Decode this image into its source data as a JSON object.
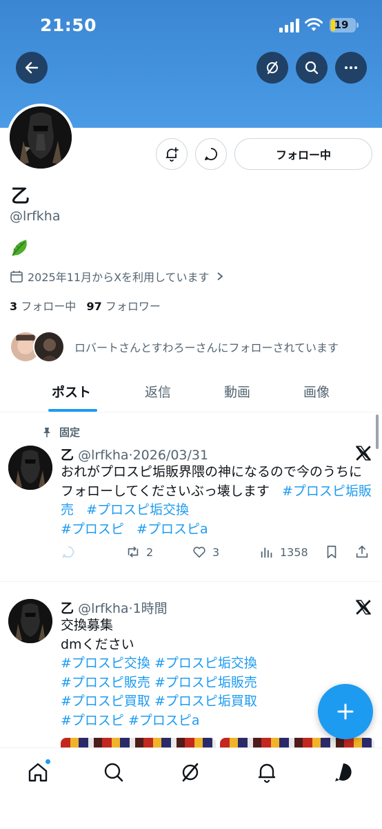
{
  "status_bar": {
    "time": "21:50",
    "battery": "19",
    "battery_level": 0.19
  },
  "header": {
    "back_icon": "back-arrow-icon",
    "grok_icon": "grok-icon",
    "search_icon": "search-icon",
    "more_icon": "more-icon"
  },
  "profile": {
    "name": "乙",
    "handle": "@lrfkha",
    "bio_emoji": "leafy-green-emoji",
    "joined": "2025年11月からXを利用しています",
    "following_count": "3",
    "following_label": "フォロー中",
    "followers_count": "97",
    "followers_label": "フォロワー",
    "followed_by": "ロバートさんとすわろーさんにフォローされています",
    "follow_button": "フォロー中"
  },
  "tabs": [
    "ポスト",
    "返信",
    "動画",
    "画像"
  ],
  "pinned_label": "固定",
  "posts": [
    {
      "name": "乙",
      "handle": "@lrfkha",
      "time": "2026/03/31",
      "text": "おれがプロスピ垢販界隈の神になるので今のうちにフォローしてくださいぶっ壊します",
      "tags_line1": [
        "#プロスピ垢販売",
        "#プロスピ垢交換"
      ],
      "tags_line2": [
        "#プロスピ",
        "#プロスピa"
      ],
      "retweets": "2",
      "likes": "3",
      "views": "1358"
    },
    {
      "name": "乙",
      "handle": "@lrfkha",
      "time": "1時間",
      "lines": [
        "交換募集",
        "dmください"
      ],
      "tag_lines": [
        "#プロスピ交換 #プロスピ垢交換",
        "#プロスピ販売 #プロスピ垢販売",
        "#プロスピ買取 #プロスピ垢買取",
        "#プロスピ #プロスピa"
      ]
    }
  ],
  "colors": {
    "accent": "#1d9bf0",
    "banner": "#4a9be6",
    "text": "#0f1419",
    "muted": "#536471"
  }
}
